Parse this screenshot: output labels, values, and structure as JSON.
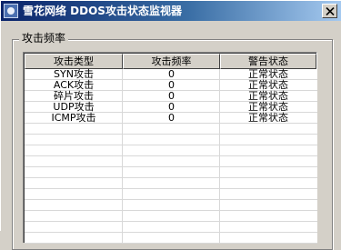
{
  "window": {
    "title": "雪花网络 DDOS攻击状态监视器",
    "close_label": "×"
  },
  "group": {
    "label": "攻击频率"
  },
  "table": {
    "columns": [
      "攻击类型",
      "攻击频率",
      "警告状态"
    ],
    "rows": [
      {
        "type": "SYN攻击",
        "freq": "0",
        "status": "正常状态"
      },
      {
        "type": "ACK攻击",
        "freq": "0",
        "status": "正常状态"
      },
      {
        "type": "碎片攻击",
        "freq": "0",
        "status": "正常状态"
      },
      {
        "type": "UDP攻击",
        "freq": "0",
        "status": "正常状态"
      },
      {
        "type": "ICMP攻击",
        "freq": "0",
        "status": "正常状态"
      }
    ]
  },
  "icons": {
    "app": "app-icon",
    "close": "close-icon"
  },
  "colors": {
    "titlebar_start": "#0a246a",
    "titlebar_end": "#a6caf0",
    "face": "#d4d0c8"
  }
}
